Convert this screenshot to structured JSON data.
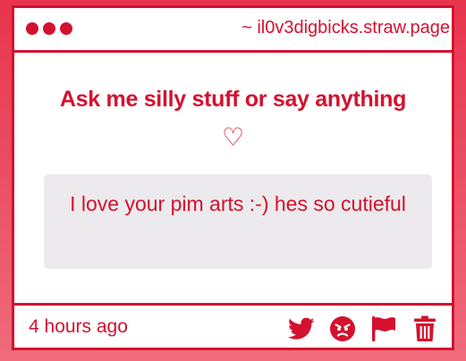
{
  "window": {
    "url": "~ il0v3digbicks.straw.page"
  },
  "main": {
    "heading": "Ask me silly stuff or say anything",
    "heart": "♡",
    "message": "I love your pim arts :-) hes so cutieful"
  },
  "footer": {
    "time": "4 hours ago",
    "actions": [
      {
        "icon": "twitter-icon"
      },
      {
        "icon": "angry-face-icon"
      },
      {
        "icon": "flag-icon"
      },
      {
        "icon": "trash-icon"
      }
    ]
  },
  "colors": {
    "accent": "#d4112f",
    "background_top": "#e8344d",
    "background_bottom": "#ef6b7c",
    "bubble": "#eceaec"
  }
}
